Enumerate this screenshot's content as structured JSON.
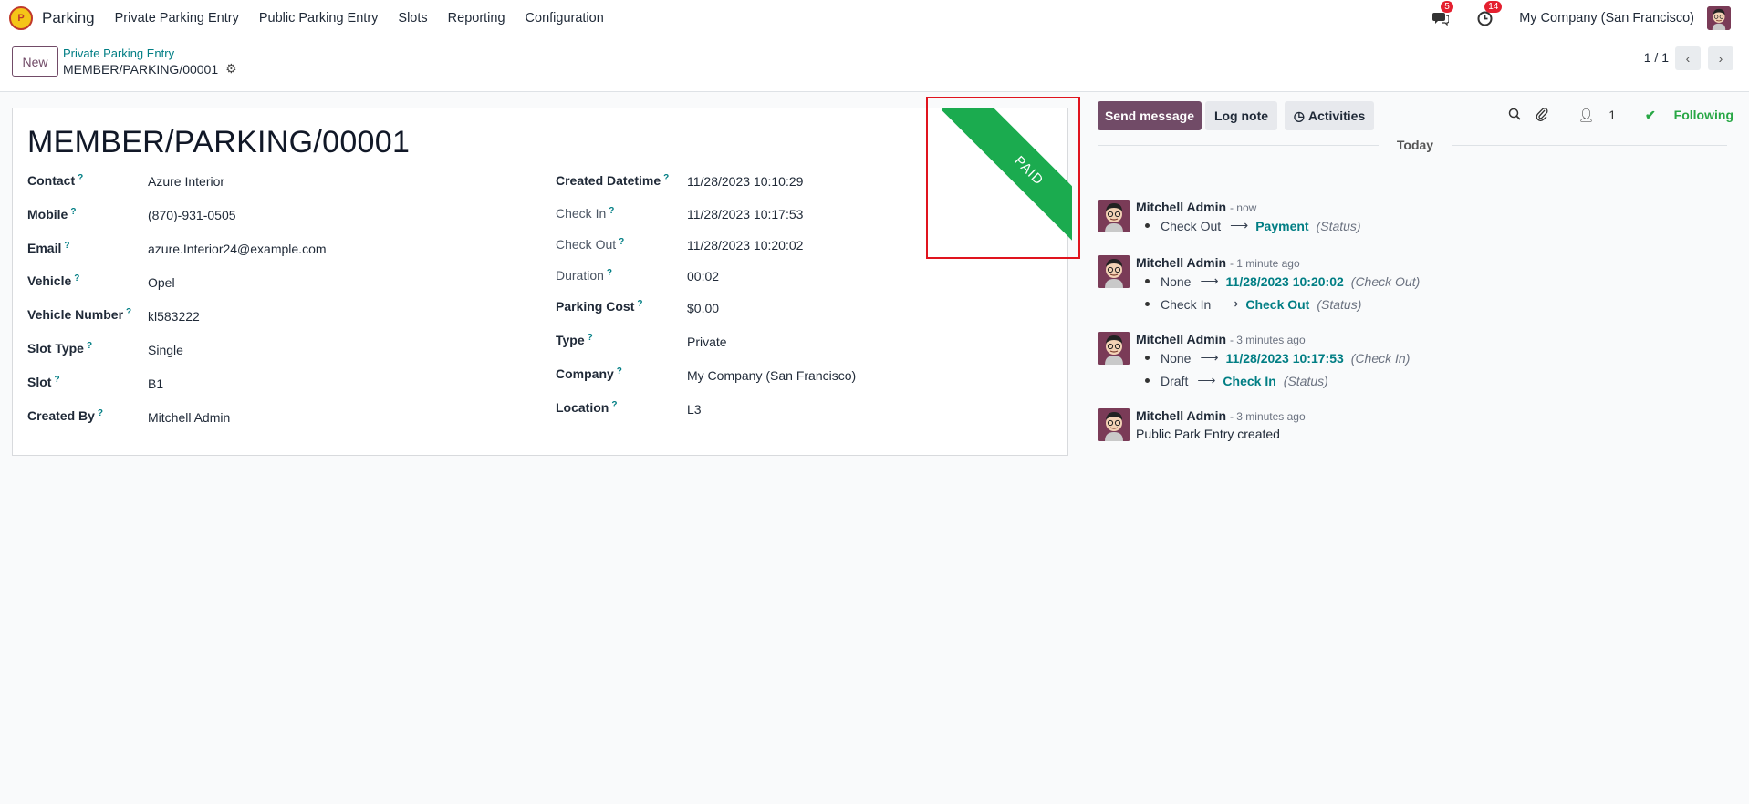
{
  "navbar": {
    "app_name": "Parking",
    "menu": [
      "Private Parking Entry",
      "Public Parking Entry",
      "Slots",
      "Reporting",
      "Configuration"
    ],
    "messages_badge": "5",
    "activities_badge": "14",
    "company": "My Company (San Francisco)"
  },
  "control": {
    "new_label": "New",
    "breadcrumb_parent": "Private Parking Entry",
    "breadcrumb_current": "MEMBER/PARKING/00001",
    "pager": "1 / 1"
  },
  "form": {
    "title": "MEMBER/PARKING/00001",
    "ribbon": "PAID",
    "left": [
      {
        "label": "Contact",
        "value": "Azure Interior"
      },
      {
        "label": "Mobile",
        "value": "(870)-931-0505"
      },
      {
        "label": "Email",
        "value": "azure.Interior24@example.com"
      },
      {
        "label": "Vehicle",
        "value": "Opel"
      },
      {
        "label": "Vehicle Number",
        "value": "kl583222"
      },
      {
        "label": "Slot Type",
        "value": "Single"
      },
      {
        "label": "Slot",
        "value": "B1"
      },
      {
        "label": "Created By",
        "value": "Mitchell Admin"
      }
    ],
    "right": [
      {
        "label": "Created Datetime",
        "value": "11/28/2023 10:10:29"
      },
      {
        "label": "Check In",
        "value": "11/28/2023 10:17:53"
      },
      {
        "label": "Check Out",
        "value": "11/28/2023 10:20:02"
      },
      {
        "label": "Duration",
        "value": "00:02"
      },
      {
        "label": "Parking Cost",
        "value": "$0.00"
      },
      {
        "label": "Type",
        "value": "Private"
      },
      {
        "label": "Company",
        "value": "My Company (San Francisco)"
      },
      {
        "label": "Location",
        "value": "L3"
      }
    ]
  },
  "chatter": {
    "send_message": "Send message",
    "log_note": "Log note",
    "activities": "Activities",
    "followers_count": "1",
    "following": "Following",
    "today": "Today",
    "messages": [
      {
        "author": "Mitchell Admin",
        "time": "- now",
        "changes": [
          {
            "old": "Check Out",
            "new": "Payment",
            "field": "(Status)"
          }
        ]
      },
      {
        "author": "Mitchell Admin",
        "time": "- 1 minute ago",
        "changes": [
          {
            "old": "None",
            "new": "11/28/2023 10:20:02",
            "field": "(Check Out)"
          },
          {
            "old": "Check In",
            "new": "Check Out",
            "field": "(Status)"
          }
        ]
      },
      {
        "author": "Mitchell Admin",
        "time": "- 3 minutes ago",
        "changes": [
          {
            "old": "None",
            "new": "11/28/2023 10:17:53",
            "field": "(Check In)"
          },
          {
            "old": "Draft",
            "new": "Check In",
            "field": "(Status)"
          }
        ]
      },
      {
        "author": "Mitchell Admin",
        "time": "- 3 minutes ago",
        "body": "Public Park Entry created"
      }
    ]
  },
  "colors": {
    "brand": "#714b67",
    "link": "#017e84",
    "ribbon": "#1bab4f",
    "highlight_border": "#e0141e",
    "badge": "#e4202f"
  }
}
